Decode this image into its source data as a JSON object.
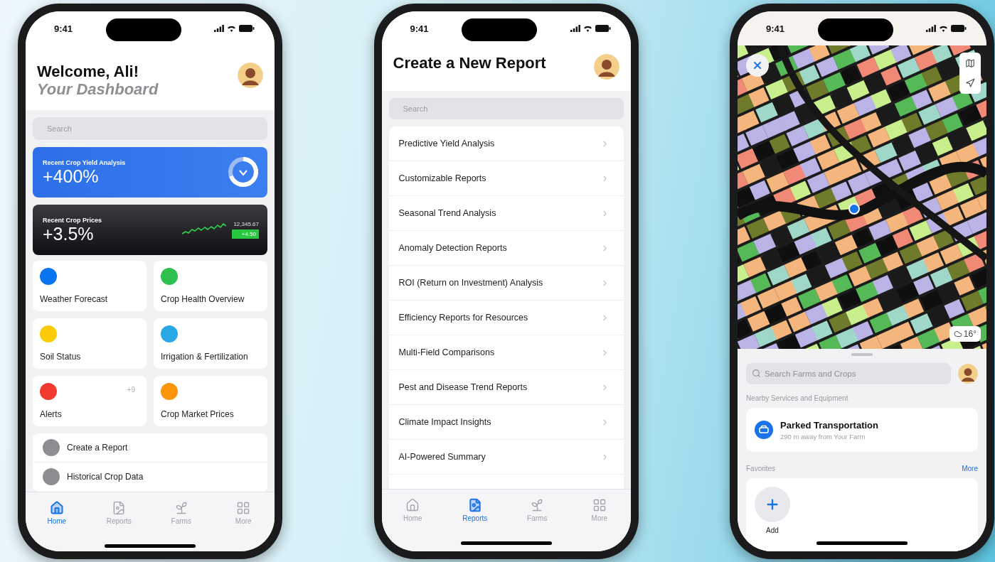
{
  "dashboard": {
    "status_time": "9:41",
    "title": "Welcome, Ali!",
    "subtitle": "Your Dashboard",
    "search": {
      "placeholder": "Search"
    },
    "yield_card": {
      "label": "Recent Crop Yield Analysis",
      "value": "+400%"
    },
    "prices_card": {
      "label": "Recent Crop Prices",
      "value": "+3.5%",
      "price": "12,345.67",
      "change": "+4.50"
    },
    "tiles": [
      {
        "label": "Weather Forecast",
        "color": "#0a74f0"
      },
      {
        "label": "Crop Health Overview",
        "color": "#2ec04f"
      },
      {
        "label": "Soil Status",
        "color": "#fccb0a"
      },
      {
        "label": "Irrigation & Fertilization",
        "color": "#2aa8e6"
      },
      {
        "label": "Alerts",
        "color": "#f23a2f",
        "badge": "+9"
      },
      {
        "label": "Crop Market Prices",
        "color": "#fb9406"
      }
    ],
    "links": [
      {
        "label": "Create a Report"
      },
      {
        "label": "Historical Crop Data"
      }
    ],
    "tabs": [
      {
        "kind": "home",
        "label": "Home",
        "selected": true
      },
      {
        "kind": "reports",
        "label": "Reports",
        "selected": false
      },
      {
        "kind": "farms",
        "label": "Farms",
        "selected": false
      },
      {
        "kind": "more",
        "label": "More",
        "selected": false
      }
    ]
  },
  "new_report": {
    "status_time": "9:41",
    "title": "Create a New Report",
    "search": {
      "placeholder": "Search"
    },
    "items": [
      "Predictive Yield Analysis",
      "Customizable Reports",
      "Seasonal Trend Analysis",
      "Anomaly Detection Reports",
      "ROI (Return on Investment) Analysis",
      "Efficiency Reports for Resources",
      "Multi-Field Comparisons",
      "Pest and Disease Trend Reports",
      "Climate Impact Insights",
      "AI-Powered Summary"
    ],
    "tabs": [
      {
        "kind": "home",
        "label": "Home",
        "selected": false
      },
      {
        "kind": "reports",
        "label": "Reports",
        "selected": true
      },
      {
        "kind": "farms",
        "label": "Farms",
        "selected": false
      },
      {
        "kind": "more",
        "label": "More",
        "selected": false
      }
    ]
  },
  "farm_map": {
    "status_time": "9:41",
    "weather": "16°",
    "search": {
      "placeholder": "Search Farms and Crops"
    },
    "nearby_heading": "Nearby Services and Equipment",
    "nearby": [
      {
        "title": "Parked Transportation",
        "subtitle": "290 m away from Your Farm"
      }
    ],
    "favorites_heading": "Favorites",
    "favorites_link": "More",
    "favorites": [
      {
        "label": "Add"
      }
    ]
  }
}
